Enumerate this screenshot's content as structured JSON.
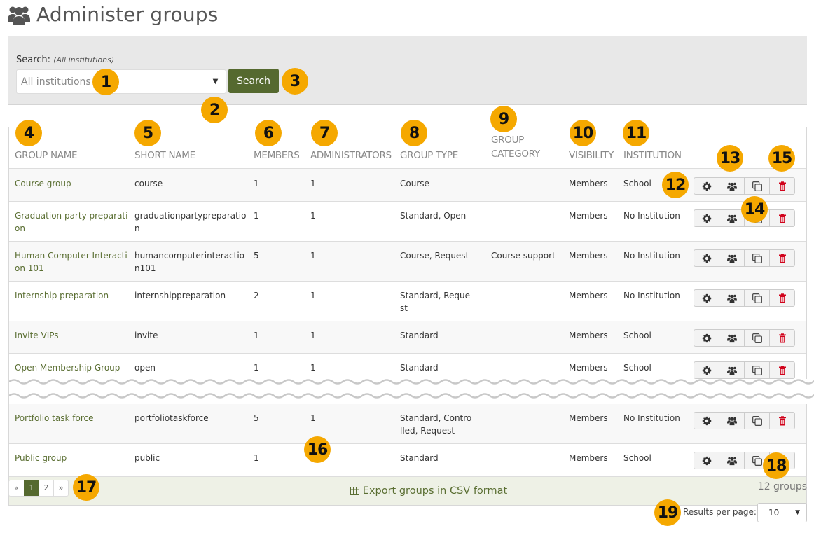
{
  "page": {
    "title": "Administer groups",
    "title_icon": "users-icon"
  },
  "search": {
    "label": "Search:",
    "scope_note": "(All institutions)",
    "institution_select_value": "All institutions",
    "button_label": "Search"
  },
  "table": {
    "columns": [
      "Group name",
      "Short name",
      "Members",
      "Administrators",
      "Group type",
      "Group category",
      "Visibility",
      "Institution",
      ""
    ],
    "rows": [
      {
        "name": "Course group",
        "short": "course",
        "members": "1",
        "admins": "1",
        "type": "Course",
        "category": "",
        "visibility": "Members",
        "institution": "School"
      },
      {
        "name": "Graduation party preparation",
        "short": "graduationpartypreparation",
        "members": "1",
        "admins": "1",
        "type": "Standard, Open",
        "category": "",
        "visibility": "Members",
        "institution": "No Institution"
      },
      {
        "name": "Human Computer Interaction 101",
        "short": "humancomputerinteraction101",
        "members": "5",
        "admins": "1",
        "type": "Course, Request",
        "category": "Course support",
        "visibility": "Members",
        "institution": "No Institution"
      },
      {
        "name": "Internship preparation",
        "short": "internshippreparation",
        "members": "2",
        "admins": "1",
        "type": "Standard, Request",
        "category": "",
        "visibility": "Members",
        "institution": "No Institution"
      },
      {
        "name": "Invite VIPs",
        "short": "invite",
        "members": "1",
        "admins": "1",
        "type": "Standard",
        "category": "",
        "visibility": "Members",
        "institution": "School"
      },
      {
        "name": "Open Membership Group",
        "short": "open",
        "members": "1",
        "admins": "1",
        "type": "Standard",
        "category": "",
        "visibility": "Members",
        "institution": "School"
      },
      {
        "name": "Portfolio task force",
        "short": "portfoliotaskforce",
        "members": "5",
        "admins": "1",
        "type": "Standard, Controlled, Request",
        "category": "",
        "visibility": "Members",
        "institution": "No Institution"
      },
      {
        "name": "Public group",
        "short": "public",
        "members": "1",
        "admins": "1",
        "type": "Standard",
        "category": "",
        "visibility": "Members",
        "institution": "School"
      }
    ],
    "row_actions": [
      "settings-icon",
      "manage-members-icon",
      "copy-icon",
      "delete-icon"
    ]
  },
  "export": {
    "label": "Export groups in CSV format",
    "icon": "table-icon"
  },
  "pagination": {
    "prev": "«",
    "pages": [
      "1",
      "2"
    ],
    "current": "1",
    "next": "»"
  },
  "results": {
    "count_text": "12 groups",
    "per_page_label": "Results per page:",
    "per_page_value": "10"
  },
  "annotations": [
    "1",
    "2",
    "3",
    "4",
    "5",
    "6",
    "7",
    "8",
    "9",
    "10",
    "11",
    "12",
    "13",
    "14",
    "15",
    "16",
    "17",
    "18",
    "19"
  ],
  "colors": {
    "accent": "#55692f",
    "link": "#5b6f33",
    "danger": "#d0021b",
    "badge": "#f5a800"
  }
}
